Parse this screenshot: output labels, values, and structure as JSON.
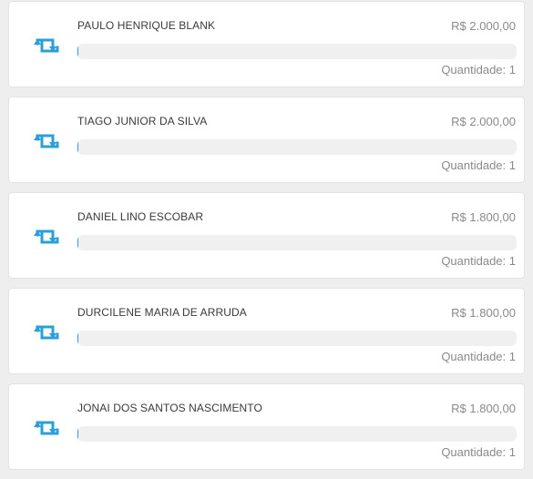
{
  "colors": {
    "accent": "#2a9fd8",
    "background": "#eeeeee",
    "card": "#ffffff",
    "track": "#f0f0f0"
  },
  "icon": "retweet-icon",
  "items": [
    {
      "name": "PAULO HENRIQUE BLANK",
      "amount": "R$ 2.000,00",
      "quantity": "Quantidade: 1",
      "progress_fraction": 0.002
    },
    {
      "name": "TIAGO JUNIOR DA SILVA",
      "amount": "R$ 2.000,00",
      "quantity": "Quantidade: 1",
      "progress_fraction": 0.002
    },
    {
      "name": "DANIEL LINO ESCOBAR",
      "amount": "R$ 1.800,00",
      "quantity": "Quantidade: 1",
      "progress_fraction": 0.002
    },
    {
      "name": "DURCILENE MARIA DE ARRUDA",
      "amount": "R$ 1.800,00",
      "quantity": "Quantidade: 1",
      "progress_fraction": 0.002
    },
    {
      "name": "JONAI DOS SANTOS NASCIMENTO",
      "amount": "R$ 1.800,00",
      "quantity": "Quantidade: 1",
      "progress_fraction": 0.002
    }
  ]
}
